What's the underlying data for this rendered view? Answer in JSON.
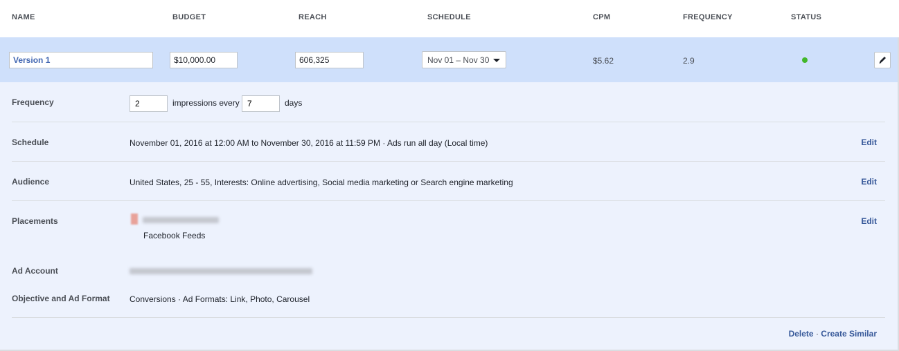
{
  "columns": {
    "name": "NAME",
    "budget": "BUDGET",
    "reach": "REACH",
    "schedule": "SCHEDULE",
    "cpm": "CPM",
    "frequency": "FREQUENCY",
    "status": "STATUS"
  },
  "version": {
    "name": "Version 1",
    "budget": "$10,000.00",
    "reach": "606,325",
    "schedule": "Nov 01 – Nov 30",
    "cpm": "$5.62",
    "frequency": "2.9",
    "status_color": "#42b72a"
  },
  "details": {
    "frequency": {
      "label": "Frequency",
      "impressions": "2",
      "mid_text": "impressions every",
      "days_value": "7",
      "days_text": "days"
    },
    "schedule": {
      "label": "Schedule",
      "text": "November 01, 2016 at 12:00 AM to November 30, 2016 at 11:59 PM · Ads run all day (Local time)",
      "edit": "Edit"
    },
    "audience": {
      "label": "Audience",
      "text": "United States, 25 - 55, Interests: Online advertising, Social media marketing or Search engine marketing",
      "edit": "Edit"
    },
    "placements": {
      "label": "Placements",
      "feed": "Facebook Feeds",
      "edit": "Edit"
    },
    "ad_account": {
      "label": "Ad Account"
    },
    "objective": {
      "label": "Objective and Ad Format",
      "text": "Conversions · Ad Formats: Link, Photo, Carousel"
    }
  },
  "footer": {
    "delete": "Delete",
    "separator": "·",
    "create_similar": "Create Similar"
  }
}
